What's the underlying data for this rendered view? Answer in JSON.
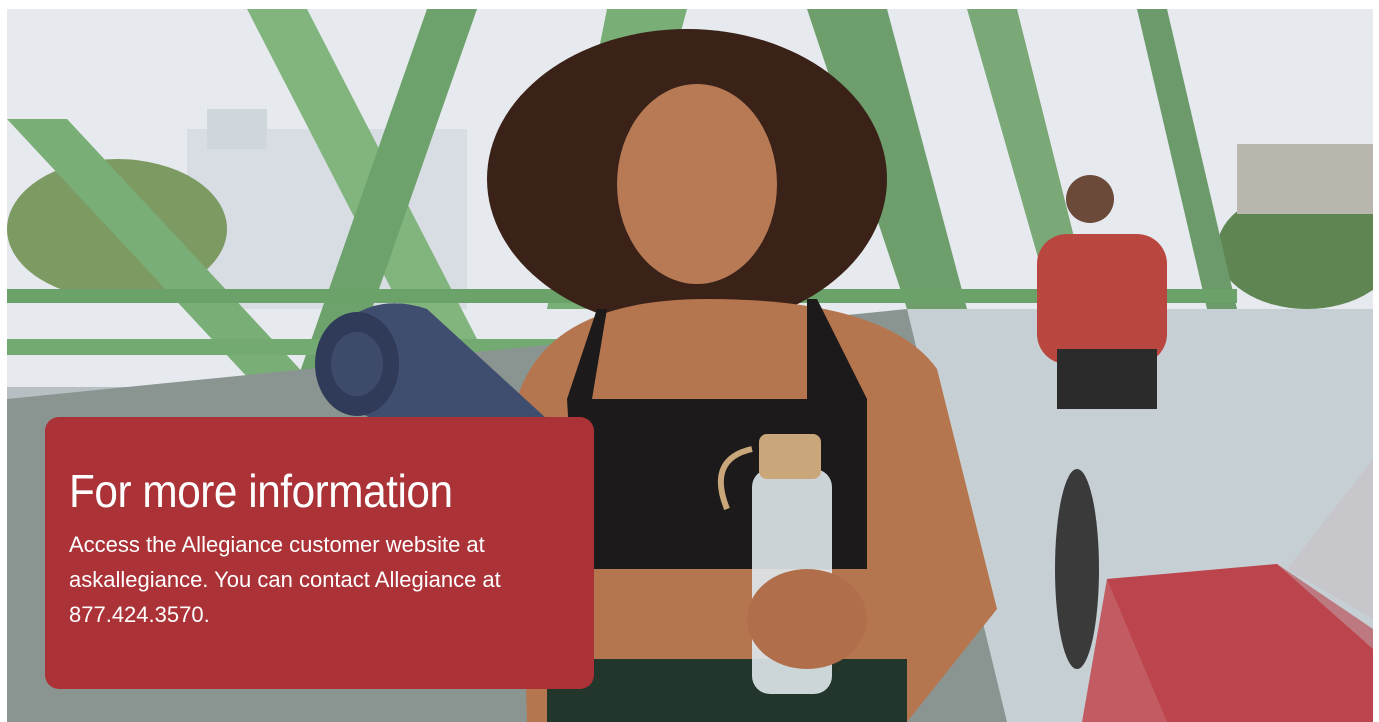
{
  "hero": {
    "image_description_icon": "photo-scene",
    "colors": {
      "card": "#ab3237",
      "triangle": "#c0363c",
      "bridge": "#7fb27a"
    }
  },
  "info_card": {
    "title": "For more information",
    "body": "Access the Allegiance customer website at askallegiance. You can contact Allegiance at 877.424.3570."
  }
}
